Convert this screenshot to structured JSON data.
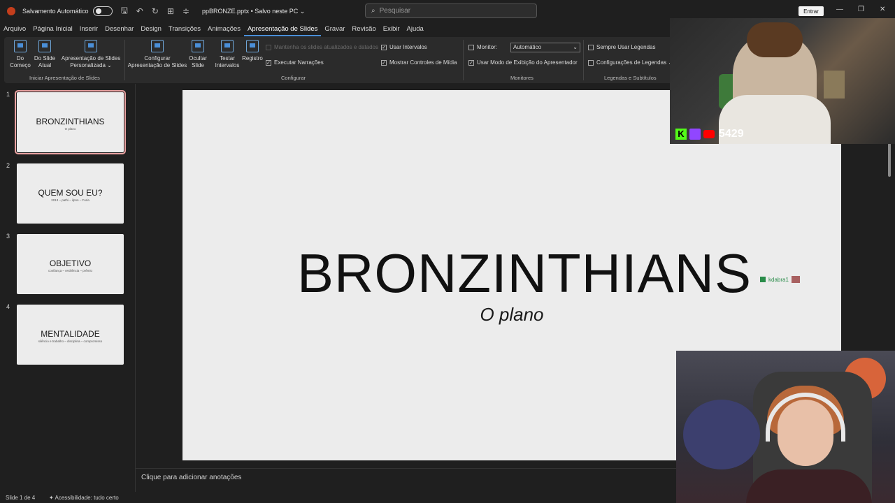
{
  "titlebar": {
    "autosave_label": "Salvamento Automático",
    "file_name": "ppBRONZE.pptx  •  Salvo neste PC ⌄",
    "search_placeholder": "Pesquisar",
    "signin_label": "Entrar"
  },
  "menu": {
    "tabs": [
      "Arquivo",
      "Página Inicial",
      "Inserir",
      "Desenhar",
      "Design",
      "Transições",
      "Animações",
      "Apresentação de Slides",
      "Gravar",
      "Revisão",
      "Exibir",
      "Ajuda"
    ],
    "active_tab": "Apresentação de Slides"
  },
  "ribbon": {
    "start": {
      "from_beginning": "Do Começo",
      "from_current": "Do Slide Atual",
      "custom": "Apresentação de Slides Personalizada ⌄",
      "group_label": "Iniciar Apresentação de Slides"
    },
    "setup": {
      "configure": "Configurar Apresentação de Slides",
      "hide": "Ocultar Slide",
      "rehearse": "Testar Intervalos",
      "record": "Registro",
      "keep_updated": "Mantenha os slides atualizados e datados",
      "play_narrations": "Executar Narrações",
      "use_timings": "Usar Intervalos",
      "show_media_controls": "Mostrar Controles de Mídia",
      "group_label": "Configurar"
    },
    "monitors": {
      "monitor_label": "Monitor:",
      "monitor_value": "Automático",
      "presenter_view": "Usar Modo de Exibição do Apresentador",
      "group_label": "Monitores"
    },
    "captions": {
      "always_use": "Sempre Usar Legendas",
      "settings": "Configurações de Legendas ⌄",
      "group_label": "Legendas e Subtítulos"
    }
  },
  "thumbnails": [
    {
      "num": "1",
      "title": "BRONZINTHIANS",
      "sub": "O plano"
    },
    {
      "num": "2",
      "title": "QUEM SOU EU?",
      "sub": "2013 – pathi – ilpnn – Furia"
    },
    {
      "num": "3",
      "title": "OBJETIVO",
      "sub": "confiança – resiliência – prêmio"
    },
    {
      "num": "4",
      "title": "MENTALIDADE",
      "sub": "silêncio e trabalho – disciplina – compromisso"
    }
  ],
  "slide": {
    "title": "BRONZINTHIANS",
    "subtitle": "O plano",
    "overlay_user": "kdabra1"
  },
  "notes_placeholder": "Clique para adicionar anotações",
  "status": {
    "slide_count": "Slide 1 de 4",
    "accessibility": "Acessibilidade: tudo certo"
  },
  "stream": {
    "k_glyph": "K",
    "viewer_count": "5429"
  }
}
